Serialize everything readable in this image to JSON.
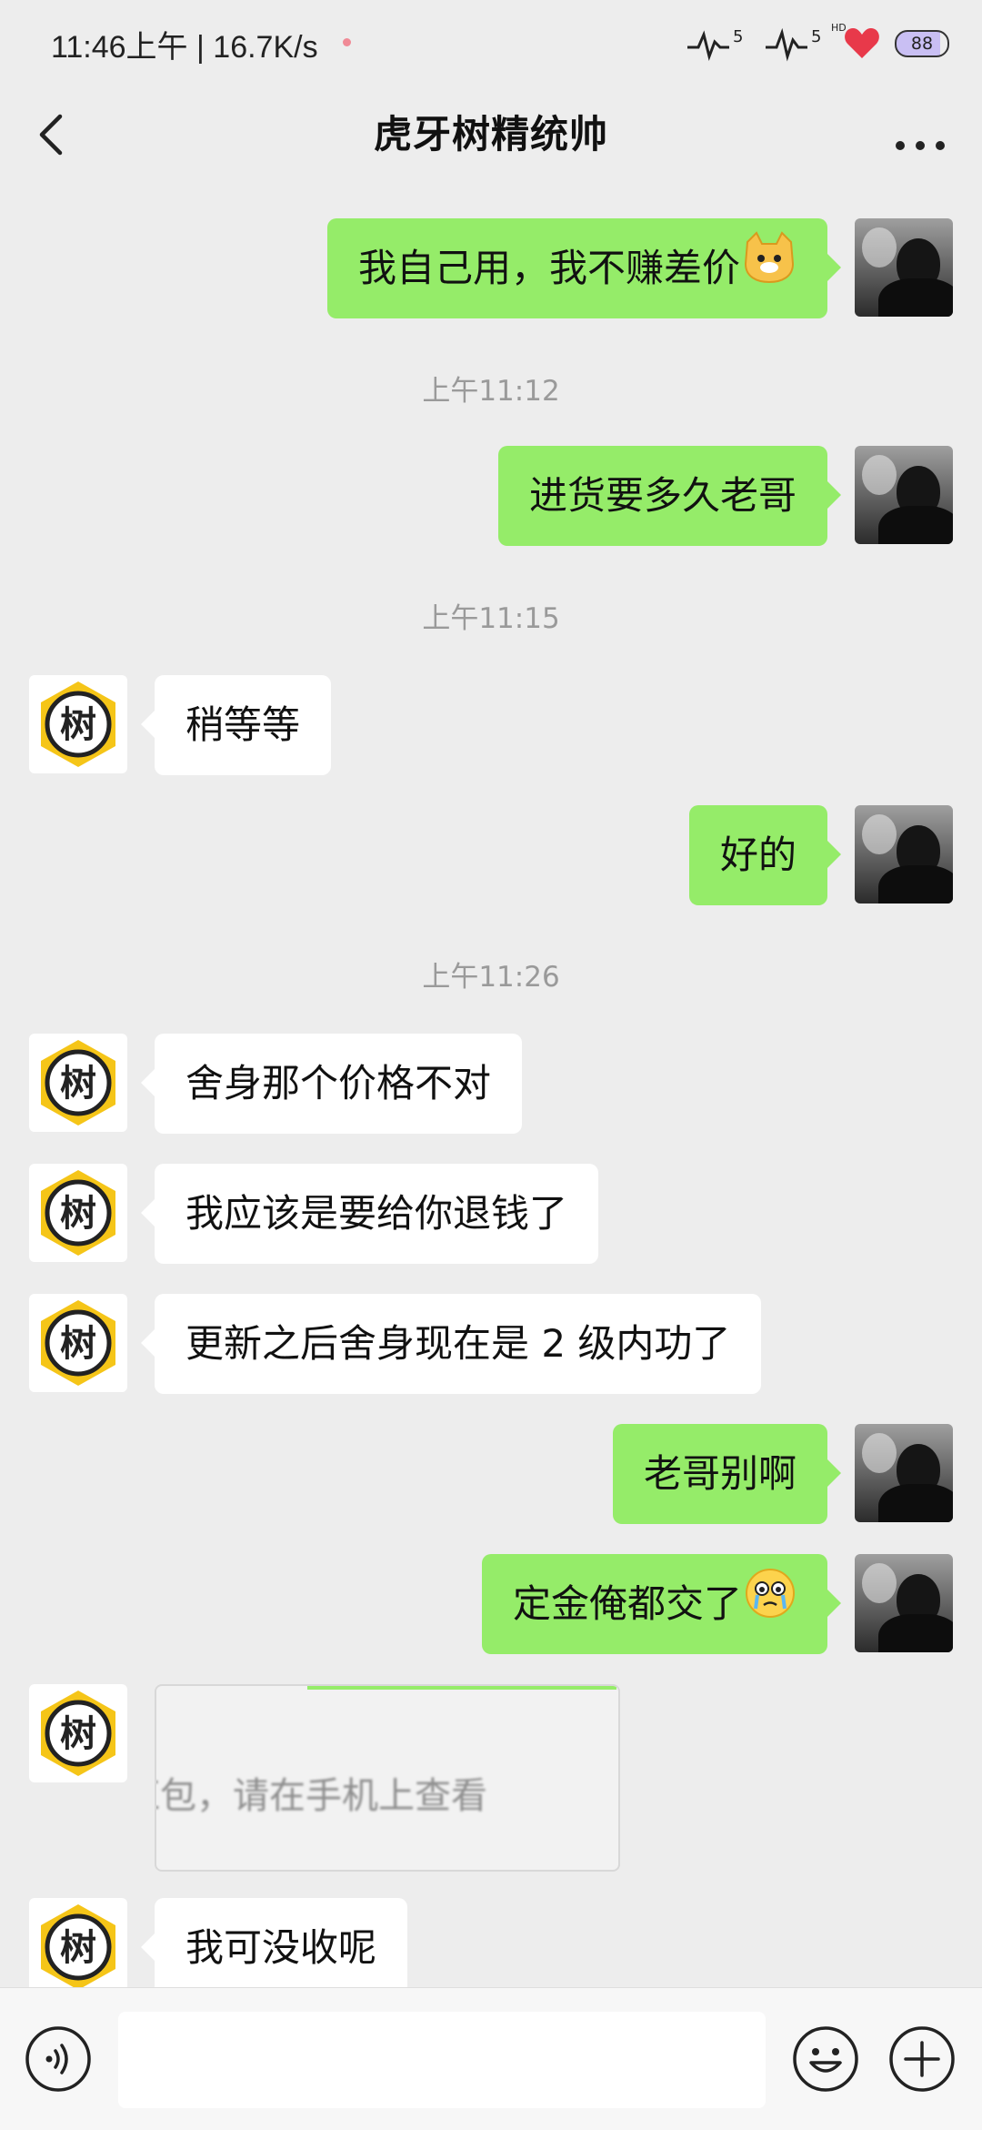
{
  "status_bar": {
    "time": "11:46上午 | 16.7K/s",
    "signal1": "5",
    "signal2": "5",
    "hd": "HD",
    "battery": "88"
  },
  "header": {
    "title": "虎牙树精统帅"
  },
  "messages": [
    {
      "side": "me",
      "text": "我自己用，我不赚差价",
      "emoji": "cat-face-emoji"
    },
    {
      "side": "time",
      "text": "上午11:12"
    },
    {
      "side": "me",
      "text": "进货要多久老哥"
    },
    {
      "side": "time",
      "text": "上午11:15"
    },
    {
      "side": "them",
      "text": "稍等等"
    },
    {
      "side": "me",
      "text": "好的"
    },
    {
      "side": "time",
      "text": "上午11:26"
    },
    {
      "side": "them",
      "text": "舍身那个价格不对"
    },
    {
      "side": "them",
      "text": "我应该是要给你退钱了"
    },
    {
      "side": "them",
      "text": "更新之后舍身现在是 2 级内功了"
    },
    {
      "side": "me",
      "text": "老哥别啊"
    },
    {
      "side": "me",
      "text": "定金俺都交了",
      "emoji": "crying-face-emoji"
    },
    {
      "side": "them",
      "type": "red-packet",
      "text": "红包，请在手机上查看"
    },
    {
      "side": "them",
      "text": "我可没收呢"
    }
  ],
  "avatar_glyph": "树",
  "colors": {
    "background": "#ededed",
    "my_bubble": "#95ec69",
    "their_bubble": "#ffffff",
    "timestamp": "#9a9a9a",
    "avatar_ring": "#f5c518"
  }
}
